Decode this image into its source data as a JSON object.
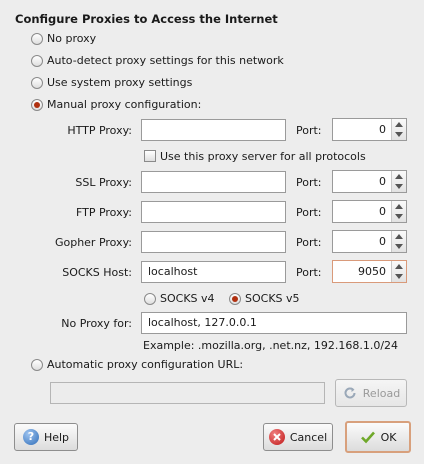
{
  "dialog": {
    "title": "Configure Proxies to Access the Internet"
  },
  "options": {
    "no_proxy": "No proxy",
    "auto_detect": "Auto-detect proxy settings for this network",
    "system": "Use system proxy settings",
    "manual": "Manual proxy configuration:",
    "selected": "manual"
  },
  "manual": {
    "http_label": "HTTP Proxy:",
    "http_value": "",
    "http_port_label": "Port:",
    "http_port": "0",
    "share_label": "Use this proxy server for all protocols",
    "share_checked": false,
    "ssl_label": "SSL Proxy:",
    "ssl_value": "",
    "ssl_port_label": "Port:",
    "ssl_port": "0",
    "ftp_label": "FTP Proxy:",
    "ftp_value": "",
    "ftp_port_label": "Port:",
    "ftp_port": "0",
    "gopher_label": "Gopher Proxy:",
    "gopher_value": "",
    "gopher_port_label": "Port:",
    "gopher_port": "0",
    "socks_label": "SOCKS Host:",
    "socks_value": "localhost",
    "socks_port_label": "Port:",
    "socks_port": "9050",
    "socks_v4": "SOCKS v4",
    "socks_v5": "SOCKS v5",
    "socks_version_selected": "v5",
    "noproxy_label": "No Proxy for:",
    "noproxy_value": "localhost, 127.0.0.1",
    "example": "Example: .mozilla.org, .net.nz, 192.168.1.0/24"
  },
  "auto_config": {
    "label": "Automatic proxy configuration URL:",
    "url": "",
    "reload": "Reload"
  },
  "buttons": {
    "help": "Help",
    "cancel": "Cancel",
    "ok": "OK"
  },
  "colors": {
    "radio_selected": "#b03010",
    "default_button_border": "#d8a07c",
    "focus_spin_border": "#d99a7a"
  }
}
